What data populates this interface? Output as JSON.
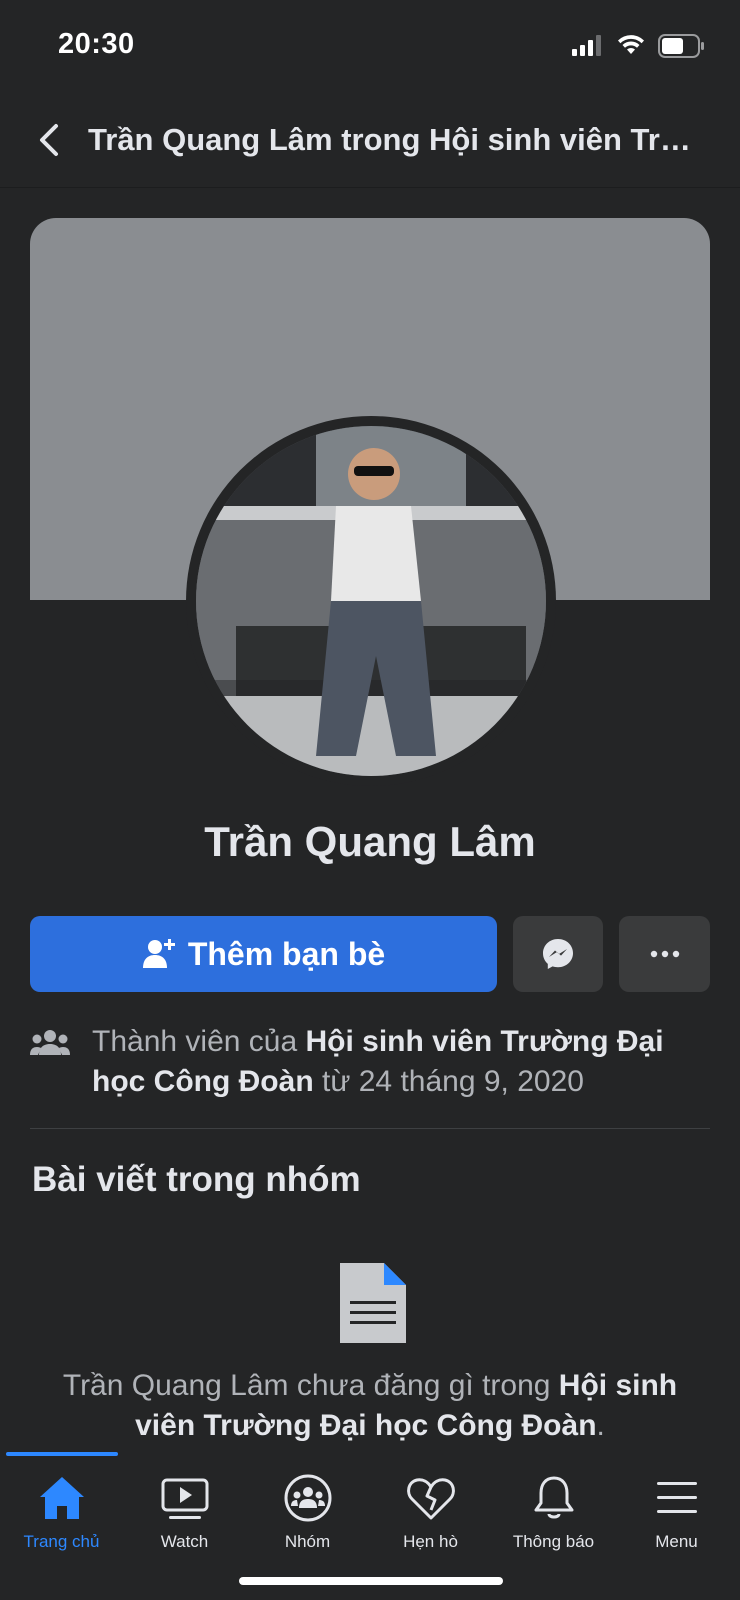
{
  "status": {
    "time": "20:30"
  },
  "header": {
    "title": "Trần Quang Lâm trong Hội sinh viên Trường Đại học Công Đoàn"
  },
  "profile": {
    "name": "Trần Quang Lâm"
  },
  "actions": {
    "add_friend_label": "Thêm bạn bè"
  },
  "membership": {
    "prefix": "Thành viên của ",
    "group_name": "Hội sinh viên Trường Đại học Công Đoàn",
    "suffix": " từ 24 tháng 9, 2020"
  },
  "posts_section": {
    "title": "Bài viết trong nhóm",
    "empty_prefix": "Trần Quang Lâm chưa đăng gì trong ",
    "empty_group": "Hội sinh viên Trường Đại học Công Đoàn",
    "empty_suffix": "."
  },
  "tabs": [
    {
      "label": "Trang chủ",
      "icon": "home-icon",
      "active": true
    },
    {
      "label": "Watch",
      "icon": "watch-icon",
      "active": false
    },
    {
      "label": "Nhóm",
      "icon": "groups-icon",
      "active": false
    },
    {
      "label": "Hẹn hò",
      "icon": "dating-heart-icon",
      "active": false
    },
    {
      "label": "Thông báo",
      "icon": "bell-icon",
      "active": false
    },
    {
      "label": "Menu",
      "icon": "menu-icon",
      "active": false
    }
  ],
  "colors": {
    "background": "#242526",
    "accent": "#2d6fdd",
    "active_tab": "#2d88ff",
    "cover": "#8a8d91"
  }
}
